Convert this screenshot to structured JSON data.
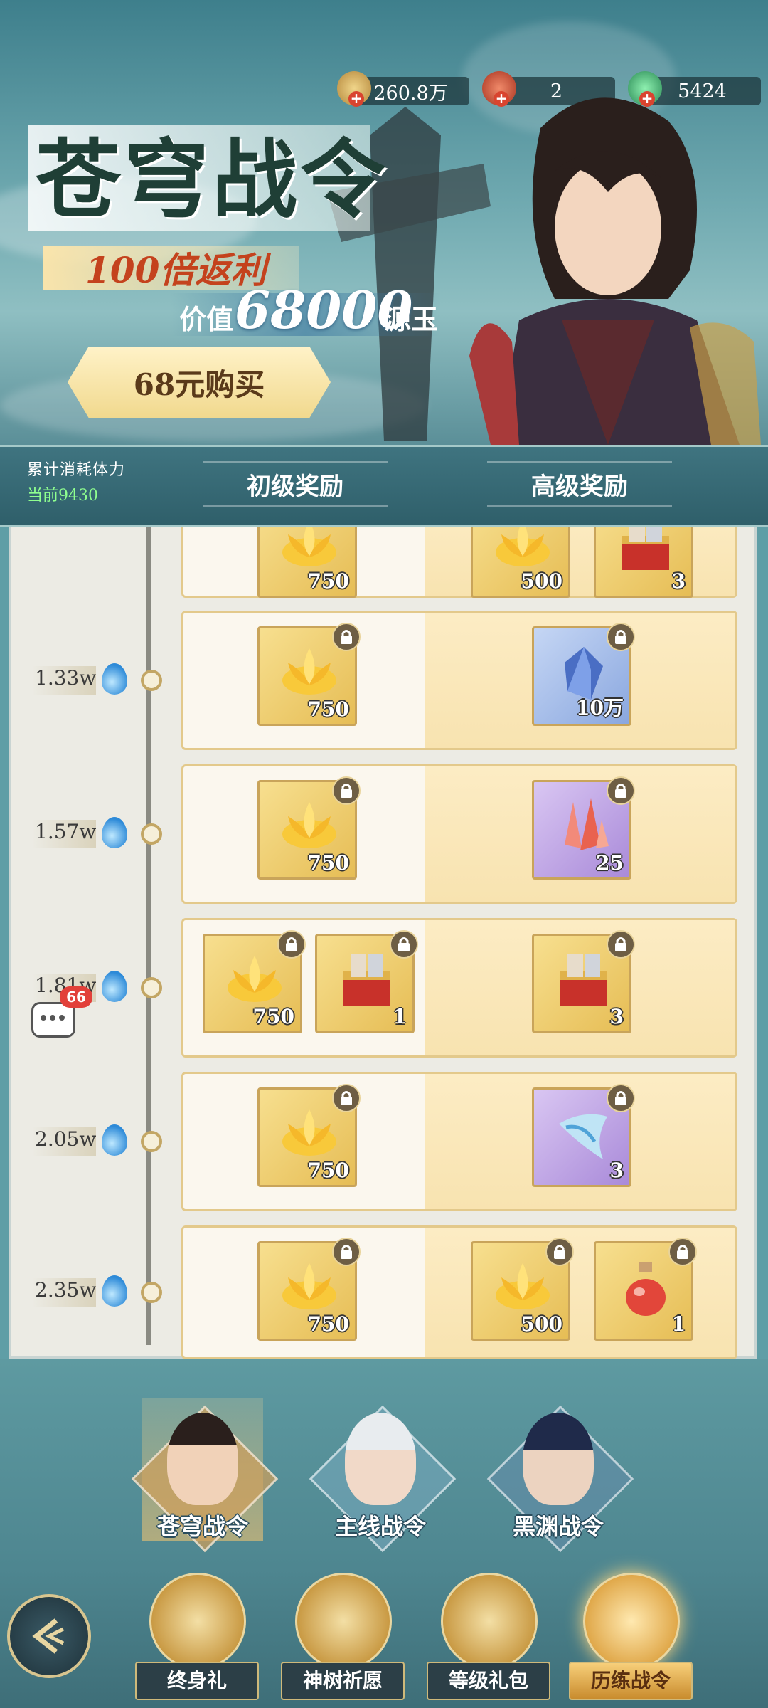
{
  "resources": [
    {
      "icon": "coin-icon",
      "value": "260.8万",
      "color": "#c9a04a"
    },
    {
      "icon": "red-charm-icon",
      "value": "2",
      "color": "#c84a3a"
    },
    {
      "icon": "jade-icon",
      "value": "5424",
      "color": "#3aa070"
    }
  ],
  "banner": {
    "title": "苍穹战令",
    "promo": "100倍返利",
    "value_prefix": "价值",
    "value_number": "68000",
    "value_suffix": "源玉",
    "buy_button": "68元购买"
  },
  "header": {
    "stamina_label": "累计消耗体力",
    "stamina_current": "当前9430",
    "tab_basic": "初级奖励",
    "tab_advanced": "高级奖励"
  },
  "rows": [
    {
      "milestone": "",
      "basic": [
        {
          "type": "gold",
          "glyph": "lotus",
          "qty": "750"
        }
      ],
      "advanced": [
        {
          "type": "gold",
          "glyph": "lotus",
          "qty": "500"
        },
        {
          "type": "gold",
          "glyph": "chest",
          "qty": "3"
        }
      ]
    },
    {
      "milestone": "1.33w",
      "basic": [
        {
          "type": "gold",
          "glyph": "lotus",
          "qty": "750"
        }
      ],
      "advanced": [
        {
          "type": "blue",
          "glyph": "crystal",
          "qty": "10万"
        }
      ]
    },
    {
      "milestone": "1.57w",
      "basic": [
        {
          "type": "gold",
          "glyph": "lotus",
          "qty": "750"
        }
      ],
      "advanced": [
        {
          "type": "purple",
          "glyph": "shard",
          "qty": "25"
        }
      ]
    },
    {
      "milestone": "1.81w",
      "basic": [
        {
          "type": "gold",
          "glyph": "lotus",
          "qty": "750"
        },
        {
          "type": "gold",
          "glyph": "chest",
          "qty": "1"
        }
      ],
      "advanced": [
        {
          "type": "gold",
          "glyph": "chest",
          "qty": "3"
        }
      ]
    },
    {
      "milestone": "2.05w",
      "basic": [
        {
          "type": "gold",
          "glyph": "lotus",
          "qty": "750"
        }
      ],
      "advanced": [
        {
          "type": "purple",
          "glyph": "cloth",
          "qty": "3"
        }
      ]
    },
    {
      "milestone": "2.35w",
      "basic": [
        {
          "type": "gold",
          "glyph": "lotus",
          "qty": "750"
        }
      ],
      "advanced": [
        {
          "type": "gold",
          "glyph": "lotus",
          "qty": "500"
        },
        {
          "type": "gold",
          "glyph": "potion",
          "qty": "1"
        }
      ]
    }
  ],
  "chat_badge": "66",
  "pass_tabs": [
    {
      "label": "苍穹战令",
      "active": true
    },
    {
      "label": "主线战令",
      "active": false
    },
    {
      "label": "黑渊战令",
      "active": false
    }
  ],
  "nav": [
    {
      "label": "终身礼",
      "icon": "scroll-gift-icon"
    },
    {
      "label": "神树祈愿",
      "icon": "golden-tree-icon"
    },
    {
      "label": "等级礼包",
      "icon": "gift-bag-icon"
    },
    {
      "label": "历练战令",
      "icon": "command-token-icon",
      "active": true
    }
  ]
}
